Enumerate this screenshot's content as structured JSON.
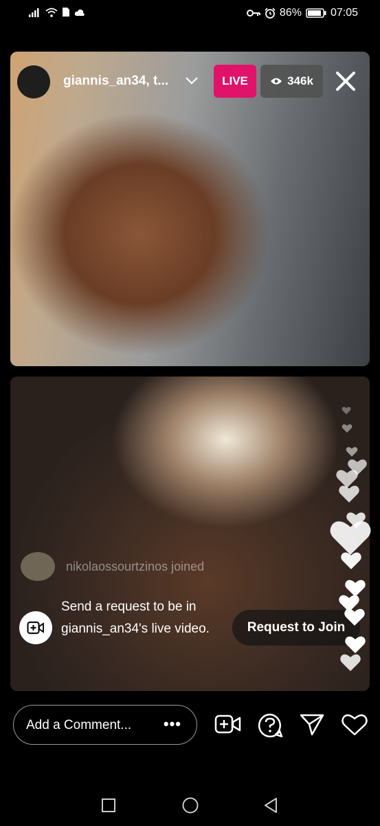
{
  "status_bar": {
    "battery_percent": "86%",
    "time": "07:05"
  },
  "live_header": {
    "username": "giannis_an34, t...",
    "live_label": "LIVE",
    "viewer_count": "346k"
  },
  "chat": {
    "joined_text": "nikolaossourtzinos joined",
    "request_text": "Send a request to be in giannis_an34's live video.",
    "request_button": "Request to Join"
  },
  "bottom_bar": {
    "comment_placeholder": "Add a Comment...",
    "more_label": "•••"
  },
  "icons": {
    "signal": "signal-icon",
    "wifi": "wifi-icon",
    "key": "key-icon",
    "alarm": "alarm-icon",
    "battery": "battery-icon",
    "eye": "eye-icon",
    "close": "close-icon",
    "chevron": "chevron-down-icon",
    "add_video": "add-video-icon",
    "question": "question-icon",
    "send": "send-icon",
    "heart": "heart-icon"
  },
  "colors": {
    "live_badge": "#e0126a",
    "background": "#000000"
  }
}
